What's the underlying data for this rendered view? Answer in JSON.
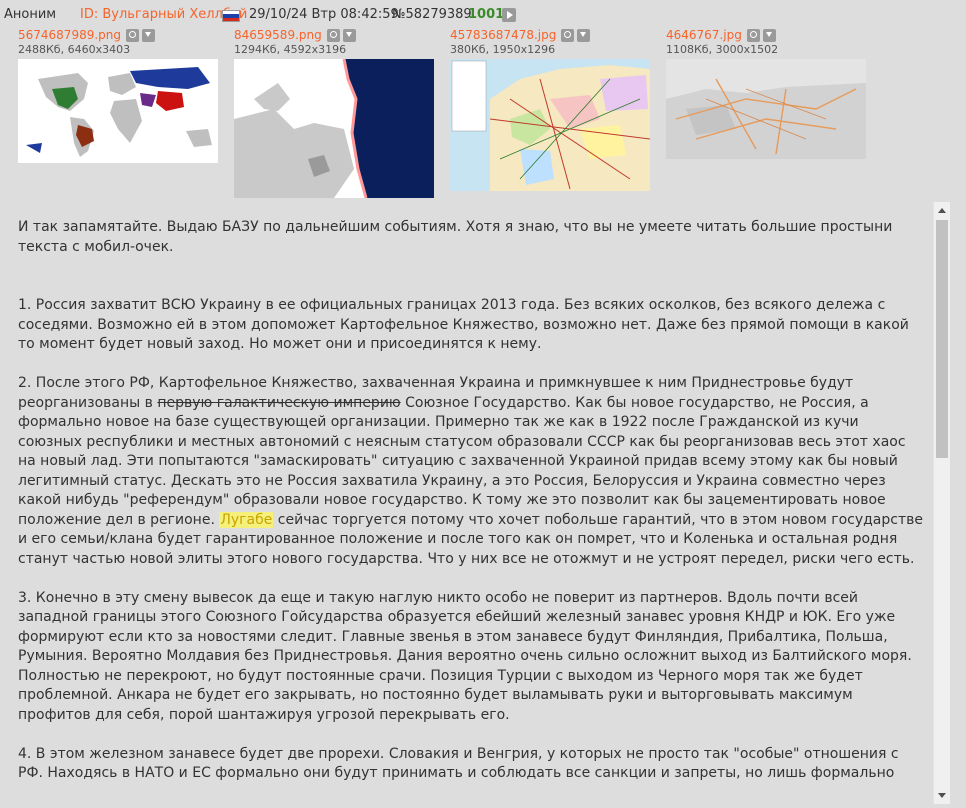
{
  "post": {
    "anon_label": "Аноним",
    "id_label": "ID: Вульгарный Хеллбой",
    "flag": {
      "name": "russia-flag",
      "colors": [
        "#ffffff",
        "#1c3faa",
        "#d52b1e"
      ]
    },
    "date": "29/10/24 Втр 08:42:59",
    "number": "№58279389",
    "count": "1001"
  },
  "files": [
    {
      "name": "5674687989.png",
      "meta": "2488Кб, 6460x3403",
      "icon": "world-map-thumbnail"
    },
    {
      "name": "84659589.png",
      "meta": "1294Кб, 4592x3196",
      "icon": "europe-map-thumbnail"
    },
    {
      "name": "45783687478.jpg",
      "meta": "380Кб, 1950x1296",
      "icon": "europe-political-map-thumbnail"
    },
    {
      "name": "4646767.jpg",
      "meta": "1108Кб, 3000x1502",
      "icon": "eurasia-map-thumbnail"
    }
  ],
  "text": {
    "intro": "И так запамятайте. Выдаю БАЗУ по дальнейшим событиям. Хотя я знаю, что вы не умеете читать большие простыни текста с мобил-очек.",
    "p1": "1. Россия захватит ВСЮ Украину в ее официальных границах 2013 года. Без всяких осколков, без всякого дележа с соседями. Возможно ей в этом допоможет Картофельное Княжество, возможно нет. Даже без прямой помощи в какой то момент будет новый заход. Но может они и присоединятся к нему.",
    "p2_a": "2. После этого РФ, Картофельное Княжество, захваченная Украина и примкнувшее к ним Приднестровье будут реорганизованы в ",
    "p2_strike": "первую галактическую империю",
    "p2_b": " Союзное Государство. Как бы новое государство, не Россия, а формально новое на базе существующей организации. Примерно так же как в 1922 после Гражданской из кучи союзных республики и местных автономий с неясным статусом образовали СССР как бы реорганизовав весь этот хаос на новый лад. Эти попытаются \"замаскировать\" ситуацию с захваченной Украиной придав всему этому как бы новый легитимный статус. Дескать это не Россия захватила Украину, а это Россия, Белоруссия и Украина совместно через какой нибудь \"референдум\" образовали новое государство. К тому же это позволит как бы зацементировать новое положение дел в регионе. ",
    "p2_hl": "Лугабе",
    "p2_c": " сейчас торгуется потому что хочет побольше гарантий, что в этом новом государстве и его семьи/клана будет гарантированное положение и после того как он помрет, что и Коленька и остальная родня станут частью новой элиты этого нового государства. Что у них все не отожмут и не устроят передел, риски чего есть.",
    "p3": "3. Конечно в эту смену вывесок да еще и такую наглую никто особо не поверит из партнеров. Вдоль почти всей западной границы этого Союзного Гойсударства образуется ебейший железный занавес уровня КНДР и ЮК. Его уже формируют если кто за новостями следит. Главные звенья в этом занавесе будут Финляндия, Прибалтика, Польша, Румыния. Вероятно Молдавия без Приднестровья. Дания вероятно очень сильно осложнит выход из Балтийского моря. Полностью не перекроют, но будут постоянные срачи. Позиция Турции с выходом из Черного моря так же будет проблемной. Анкара не будет его закрывать, но постоянно будет выламывать руки и выторговывать максимум профитов для себя, порой шантажируя угрозой перекрывать его.",
    "p4": "4. В этом железном занавесе будет две прорехи. Словакия и Венгрия, у которых не просто так \"особые\" отношения с РФ. Находясь в НАТО и ЕС формально они будут принимать и соблюдать все санкции и запреты, но лишь формально"
  },
  "colors": {
    "background": "#dddddd",
    "accent_orange": "#f7632a",
    "count_green": "#3a8a2a",
    "highlight": "#f5f07a"
  }
}
